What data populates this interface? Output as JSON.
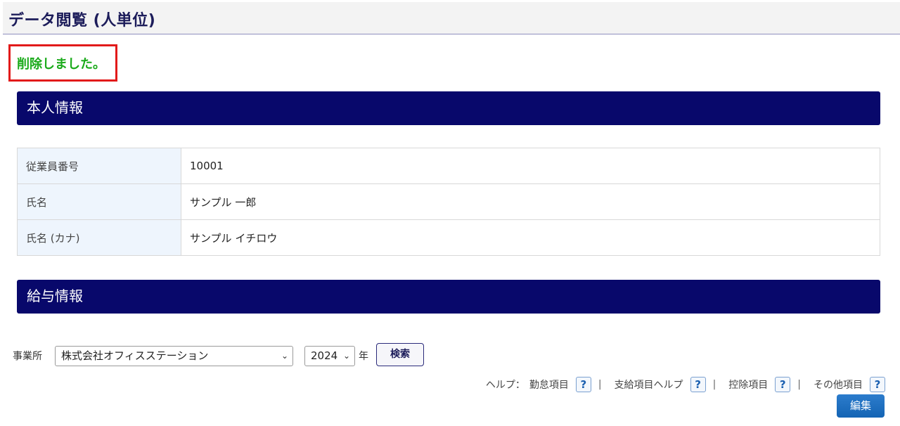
{
  "header": {
    "title": "データ閲覧 (人単位)"
  },
  "message": {
    "text": "削除しました。"
  },
  "personal_section": {
    "title": "本人情報"
  },
  "personal_table": {
    "rows": [
      {
        "label": "従業員番号",
        "value": "10001"
      },
      {
        "label": "氏名",
        "value": "サンプル 一郎"
      },
      {
        "label": "氏名 (カナ)",
        "value": "サンプル イチロウ"
      }
    ]
  },
  "salary_section": {
    "title": "給与情報"
  },
  "filters": {
    "office_label": "事業所",
    "office_selected": "株式会社オフィスステーション",
    "year_selected": "2024",
    "year_suffix": "年",
    "search_label": "検索"
  },
  "help": {
    "prefix": "ヘルプ：",
    "items": [
      "勤怠項目",
      "支給項目ヘルプ",
      "控除項目",
      "その他項目"
    ],
    "icon_glyph": "?",
    "separator": "|"
  },
  "edit_label": "編集",
  "colors": {
    "section_bar": "#08086b",
    "success_text": "#1aaa1a",
    "message_border": "#e21a1a",
    "edit_button": "#1a6ac0"
  }
}
